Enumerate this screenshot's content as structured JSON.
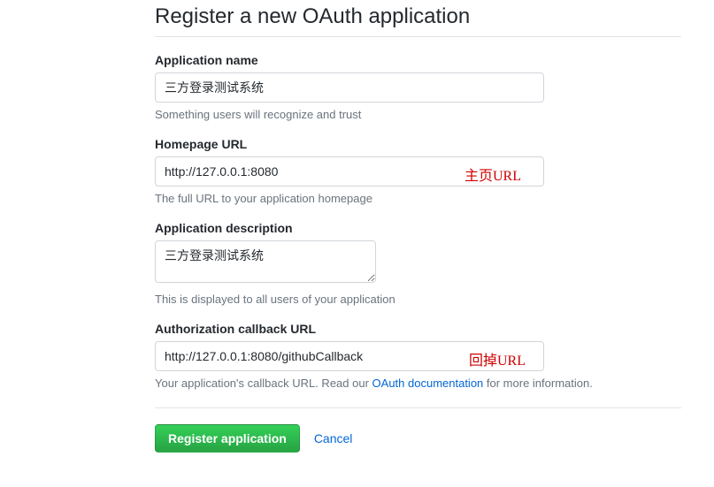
{
  "page_title": "Register a new OAuth application",
  "app_name": {
    "label": "Application name",
    "value": "三方登录测试系统",
    "help": "Something users will recognize and trust"
  },
  "homepage_url": {
    "label": "Homepage URL",
    "value": "http://127.0.0.1:8080",
    "help": "The full URL to your application homepage",
    "annotation": "主页URL"
  },
  "app_description": {
    "label": "Application description",
    "value": "三方登录测试系统",
    "help": "This is displayed to all users of your application"
  },
  "callback_url": {
    "label": "Authorization callback URL",
    "value": "http://127.0.0.1:8080/githubCallback",
    "help_prefix": "Your application's callback URL. Read our ",
    "help_link_text": "OAuth documentation",
    "help_suffix": " for more information.",
    "annotation": "回掉URL"
  },
  "actions": {
    "submit_label": "Register application",
    "cancel_label": "Cancel"
  }
}
